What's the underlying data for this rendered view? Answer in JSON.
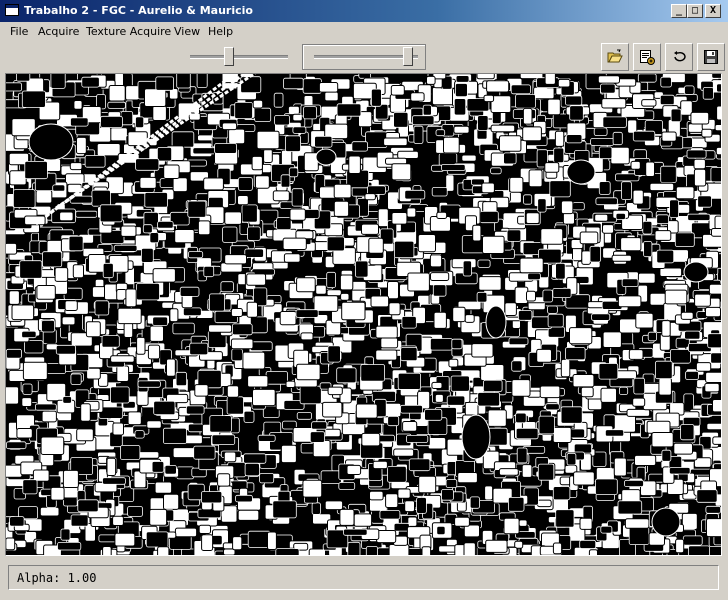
{
  "window": {
    "title": "Trabalho 2 - FGC - Aurelio & Mauricio"
  },
  "controls": {
    "minimize": "_",
    "maximize": "□",
    "close": "X"
  },
  "menu": [
    "File",
    "Acquire",
    "Texture Acquire",
    "View",
    "Help"
  ],
  "sliders": [
    {
      "name": "alpha-slider",
      "value": 0.4
    },
    {
      "name": "threshold-slider",
      "value": 0.9
    }
  ],
  "toolbar": {
    "buttons": [
      {
        "name": "open-file-button",
        "icon": "folder-open-icon"
      },
      {
        "name": "export-button",
        "icon": "export-image-icon"
      },
      {
        "name": "undo-button",
        "icon": "undo-icon"
      },
      {
        "name": "save-button",
        "icon": "save-icon"
      }
    ]
  },
  "canvas": {
    "content": "texture-image"
  },
  "status": {
    "text": "Alpha: 1.00"
  }
}
